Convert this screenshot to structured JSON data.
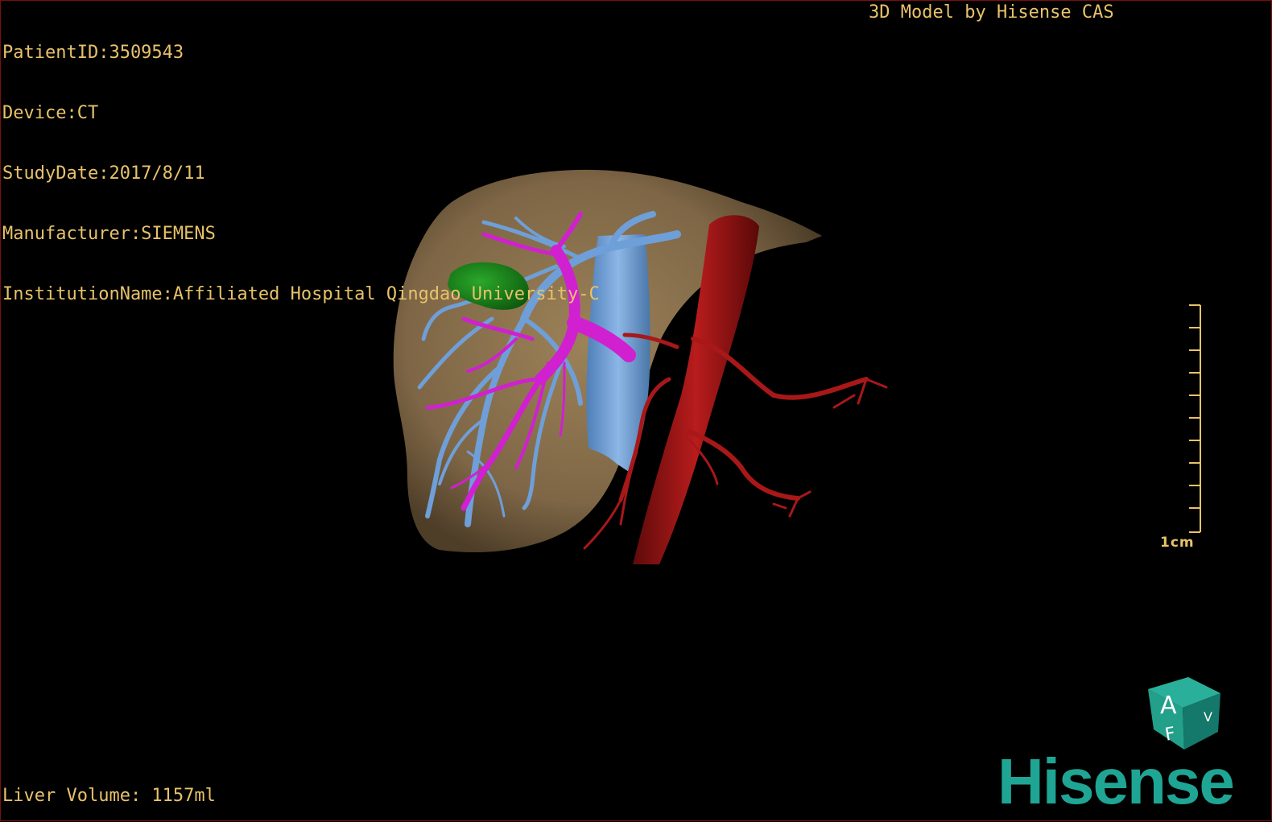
{
  "header": {
    "patient_id": "PatientID:3509543",
    "device": "Device:CT",
    "study_date": "StudyDate:2017/8/11",
    "manufacturer": "Manufacturer:SIEMENS",
    "institution": "InstitutionName:Affiliated Hospital Qingdao University-C"
  },
  "model_credit": "3D Model by Hisense CAS",
  "footer": {
    "liver_volume": "Liver Volume: 1157ml"
  },
  "scale_bar": {
    "label": "1cm"
  },
  "orientation_cube": {
    "letters": [
      "A",
      "F",
      "V"
    ],
    "icon": "orientation-cube-icon"
  },
  "logo": {
    "text": "Hisense"
  },
  "colors": {
    "text": "#e8c26a",
    "liver": "#8a7250",
    "portal_vein": "#6f9fd8",
    "hepatic_vein": "#d020d0",
    "artery": "#a81818",
    "lesion": "#1e8a1e",
    "logo": "#1fa594",
    "frame": "#7a1010"
  }
}
